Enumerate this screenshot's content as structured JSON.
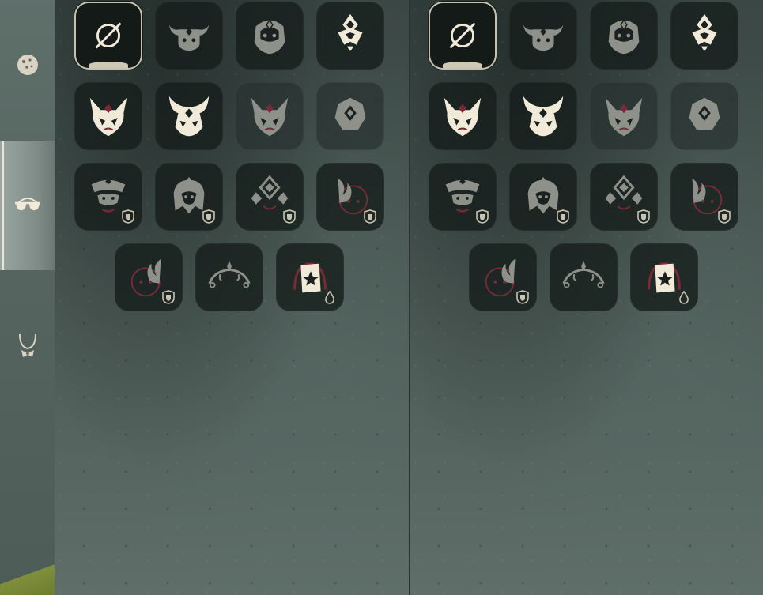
{
  "colors": {
    "icon_cream": "#f1ead9",
    "icon_muted": "#8d918a",
    "accent_red": "#7a2a36",
    "slot_dark": "#161e1c",
    "selected_outline": "#c7c2ad"
  },
  "rail": {
    "tabs": [
      {
        "icon": "cookie-icon",
        "active": false
      },
      {
        "icon": "sunglasses-icon",
        "active": true
      },
      {
        "icon": "necklace-icon",
        "active": false
      }
    ]
  },
  "panels": [
    {
      "items": [
        {
          "icon": "none-slash-icon",
          "state": "selected",
          "badge": ""
        },
        {
          "icon": "bull-mask-icon",
          "state": "normal",
          "badge": ""
        },
        {
          "icon": "ornate-mask-icon",
          "state": "normal",
          "badge": ""
        },
        {
          "icon": "crest-mask-icon",
          "state": "normal",
          "badge": ""
        },
        {
          "icon": "horned-mask-icon",
          "state": "normal",
          "badge": ""
        },
        {
          "icon": "horned-crown-mask-icon",
          "state": "normal",
          "badge": ""
        },
        {
          "icon": "horned-mask-muted-icon",
          "state": "dim",
          "badge": ""
        },
        {
          "icon": "faceted-mask-muted-icon",
          "state": "dim",
          "badge": ""
        },
        {
          "icon": "helm-mask-icon",
          "state": "normal",
          "badge": "shield-badge-icon"
        },
        {
          "icon": "hood-mask-icon",
          "state": "normal",
          "badge": "shield-badge-icon"
        },
        {
          "icon": "diamond-mask-icon",
          "state": "normal",
          "badge": "shield-badge-icon"
        },
        {
          "icon": "flame-mask-icon",
          "state": "normal",
          "badge": "shield-badge-icon"
        },
        {
          "icon": "flame-face-icon",
          "state": "normal",
          "badge": "shield-badge-icon"
        },
        {
          "icon": "winged-circlet-icon",
          "state": "normal",
          "badge": ""
        },
        {
          "icon": "card-mask-icon",
          "state": "normal",
          "badge": "drop-badge-icon"
        }
      ]
    },
    {
      "items": [
        {
          "icon": "none-slash-icon",
          "state": "selected",
          "badge": ""
        },
        {
          "icon": "bull-mask-icon",
          "state": "normal",
          "badge": ""
        },
        {
          "icon": "ornate-mask-icon",
          "state": "normal",
          "badge": ""
        },
        {
          "icon": "crest-mask-icon",
          "state": "normal",
          "badge": ""
        },
        {
          "icon": "horned-mask-icon",
          "state": "normal",
          "badge": ""
        },
        {
          "icon": "horned-crown-mask-icon",
          "state": "normal",
          "badge": ""
        },
        {
          "icon": "horned-mask-muted-icon",
          "state": "dim",
          "badge": ""
        },
        {
          "icon": "faceted-mask-muted-icon",
          "state": "dim",
          "badge": ""
        },
        {
          "icon": "helm-mask-icon",
          "state": "normal",
          "badge": "shield-badge-icon"
        },
        {
          "icon": "hood-mask-icon",
          "state": "normal",
          "badge": "shield-badge-icon"
        },
        {
          "icon": "diamond-mask-icon",
          "state": "normal",
          "badge": "shield-badge-icon"
        },
        {
          "icon": "flame-mask-icon",
          "state": "normal",
          "badge": "shield-badge-icon"
        },
        {
          "icon": "flame-face-icon",
          "state": "normal",
          "badge": "shield-badge-icon"
        },
        {
          "icon": "winged-circlet-icon",
          "state": "normal",
          "badge": ""
        },
        {
          "icon": "card-mask-icon",
          "state": "normal",
          "badge": "drop-badge-icon"
        }
      ]
    }
  ]
}
